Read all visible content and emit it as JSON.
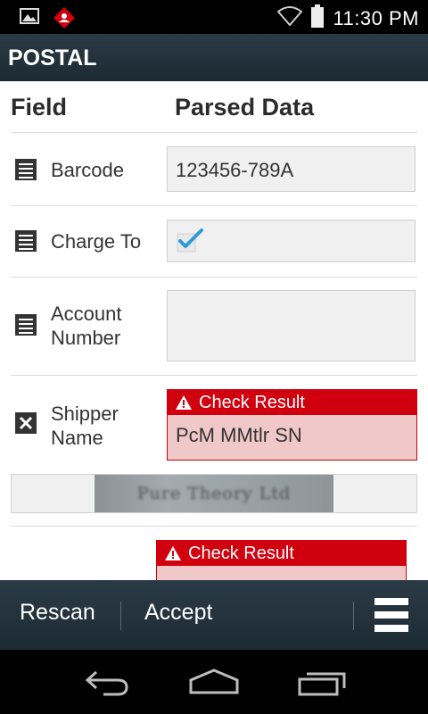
{
  "status_bar": {
    "time": "11:30 PM",
    "icons": [
      "image-notification-icon",
      "app-notification-icon",
      "wifi-icon",
      "battery-icon"
    ]
  },
  "title_bar": {
    "title": "POSTAL"
  },
  "table": {
    "header_field": "Field",
    "header_parsed": "Parsed Data",
    "rows": [
      {
        "icon": "form-field-icon",
        "label": "Barcode",
        "value": "123456-789A"
      },
      {
        "icon": "form-field-icon",
        "label": "Charge To",
        "checked": true
      },
      {
        "icon": "form-field-icon",
        "label": "Account Number",
        "label_line1": "Account",
        "label_line2": "Number",
        "value": ""
      },
      {
        "icon": "error-x-icon",
        "label": "Shipper Name",
        "label_line1": "Shipper",
        "label_line2": "Name",
        "check_label": "Check Result",
        "value": "PcM MMtlr SN"
      },
      {
        "check_label": "Check Result",
        "value": ""
      }
    ],
    "image_strip_text": "Pure Theory Ltd"
  },
  "action_bar": {
    "rescan_label": "Rescan",
    "accept_label": "Accept"
  },
  "nav_bar": {
    "icons": [
      "back-icon",
      "home-icon",
      "recent-apps-icon"
    ]
  },
  "colors": {
    "bar_bg": "#1f2d36",
    "error_red": "#d0000f",
    "error_bg": "#f1c8c8",
    "checkmark": "#2e9bd6"
  }
}
